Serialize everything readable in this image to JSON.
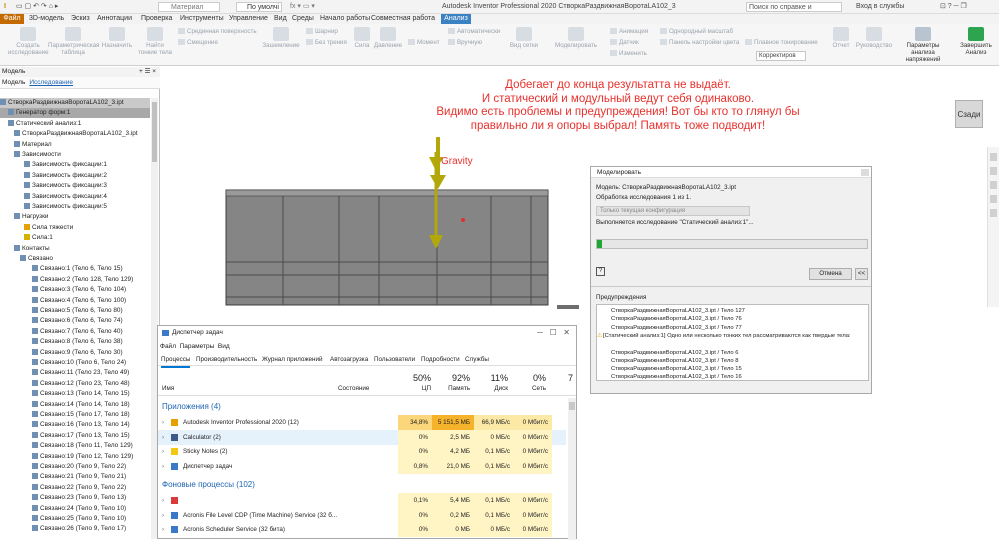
{
  "app": {
    "title": "Autodesk Inventor Professional 2020   СтворкаРаздвижнаяВоротаLA102_3",
    "material": "Материал",
    "view_mode": "По умолчі",
    "search_placeholder": "Поиск по справке и командам",
    "sign_in": "Вход в службы"
  },
  "tabs": [
    "Файл",
    "3D-модель",
    "Эскиз",
    "Аннотации",
    "Проверка",
    "Инструменты",
    "Управление",
    "Вид",
    "Среды",
    "Начало работы",
    "Совместная работа",
    "Анализ"
  ],
  "ribbon": {
    "big": [
      "Создать исследование",
      "Параметрическая таблица",
      "Назначить",
      "Найти тонкие тела",
      "Зашемление",
      "Сила",
      "Давление",
      "Моделировать",
      "Вид сетки",
      "Моделировать",
      "Отчет",
      "Руководство",
      "Параметры анализа напряжений",
      "Завершить Анализ"
    ],
    "small": [
      "Срединная поверхность",
      "Смещение",
      "Шарнир",
      "Без трения",
      "Момент",
      "Автоматически",
      "Вручную",
      "Анимация",
      "Датчик",
      "Изменить",
      "Однородный масштаб",
      "Панель настройки цвета",
      "Плавное тонирование",
      "Корректиров"
    ]
  },
  "browser": {
    "tabs": [
      "Модель",
      "Исследование"
    ],
    "items": [
      "СтворкаРаздвижнаяВоротаLA102_3.ipt",
      "Генератор форм:1",
      "Статический анализ:1",
      "СтворкаРаздвижнаяВоротаLA102_3.ipt",
      "Материал",
      "Зависимости",
      "Зависимость фиксации:1",
      "Зависимость фиксации:2",
      "Зависимость фиксации:3",
      "Зависимость фиксации:4",
      "Зависимость фиксации:5",
      "Нагрузки",
      "Сила тяжести",
      "Сила:1",
      "Контакты",
      "Связано",
      "Связано:1 (Тело 6, Тело 15)",
      "Связано:2 (Тело 128, Тело 129)",
      "Связано:3 (Тело 6, Тело 104)",
      "Связано:4 (Тело 6, Тело 100)",
      "Связано:5 (Тело 6, Тело 80)",
      "Связано:6 (Тело 6, Тело 74)",
      "Связано:7 (Тело 6, Тело 40)",
      "Связано:8 (Тело 6, Тело 38)",
      "Связано:9 (Тело 6, Тело 30)",
      "Связано:10 (Тело 6, Тело 24)",
      "Связано:11 (Тело 23, Тело 49)",
      "Связано:12 (Тело 23, Тело 48)",
      "Связано:13 (Тело 14, Тело 15)",
      "Связано:14 (Тело 14, Тело 18)",
      "Связано:15 (Тело 17, Тело 18)",
      "Связано:16 (Тело 13, Тело 14)",
      "Связано:17 (Тело 13, Тело 15)",
      "Связано:18 (Тело 11, Тело 129)",
      "Связано:19 (Тело 12, Тело 129)",
      "Связано:20 (Тело 9, Тело 22)",
      "Связано:21 (Тело 9, Тело 21)",
      "Связано:22 (Тело 9, Тело 22)",
      "Связано:23 (Тело 9, Тело 13)",
      "Связано:24 (Тело 9, Тело 10)",
      "Связано:25 (Тело 9, Тело 10)",
      "Связано:26 (Тело 9, Тело 17)"
    ]
  },
  "comment": [
    "Добегает до конца результатта не выдаёт.",
    "И статический и модульный ведут себя одинаково.",
    "Видимо есть проблемы и предупреждения! Вот бы кто то глянул бы",
    "правильно ли я опоры выбрал! Память тоже подводит!"
  ],
  "gravity": "Gravity",
  "viewcube": "Сзади",
  "sim": {
    "title": "Моделировать",
    "model": "Модель: СтворкаРаздвижнаяВоротаLA102_3.ipt",
    "processing": "Обработка исследования 1 из 1.",
    "config": "Только текущая конфигурация",
    "running": "Выполняется исследование \"Статический анализ:1\"...",
    "progress": 0.02,
    "cancel": "Отмена",
    "collapse": "<<",
    "warnings_label": "Предупреждения",
    "warnings": [
      "СтворкаРаздвижнаяВоротаLA102_3.ipt / Тело 127",
      "СтворкаРаздвижнаяВоротаLA102_3.ipt / Тело 76",
      "СтворкаРаздвижнаяВоротаLA102_3.ipt / Тело 77",
      "[Статический анализ:1] Одно или несколько тонких тел рассматриваются как твердые тела:",
      "",
      "СтворкаРаздвижнаяВоротаLA102_3.ipt / Тело 6",
      "СтворкаРаздвижнаяВоротаLA102_3.ipt / Тело 8",
      "СтворкаРаздвижнаяВоротаLA102_3.ipt / Тело 15",
      "СтворкаРаздвижнаяВоротаLA102_3.ipt / Тело 16"
    ]
  },
  "taskmgr": {
    "title": "Диспетчер задач",
    "menu": [
      "Файл",
      "Параметры",
      "Вид"
    ],
    "tabs": [
      "Процессы",
      "Производительность",
      "Журнал приложений",
      "Автозагрузка",
      "Пользователи",
      "Подробности",
      "Службы"
    ],
    "cols": {
      "name": "Имя",
      "status": "Состояние",
      "cpu_pct": "50%",
      "cpu": "ЦП",
      "mem_pct": "92%",
      "mem": "Память",
      "disk_pct": "11%",
      "disk": "Диск",
      "net_pct": "0%",
      "net": "Сеть",
      "extra": "7"
    },
    "apps_header": "Приложения (4)",
    "bg_header": "Фоновые процессы (102)",
    "apps": [
      {
        "name": "Autodesk Inventor Professional 2020 (12)",
        "cpu": "34,8%",
        "mem": "5 151,5 МБ",
        "disk": "66,9 МБ/с",
        "net": "0 Мбит/с"
      },
      {
        "name": "Calculator (2)",
        "cpu": "0%",
        "mem": "2,5 МБ",
        "disk": "0 МБ/с",
        "net": "0 Мбит/с"
      },
      {
        "name": "Sticky Notes (2)",
        "cpu": "0%",
        "mem": "4,2 МБ",
        "disk": "0,1 МБ/с",
        "net": "0 Мбит/с"
      },
      {
        "name": "Диспетчер задач",
        "cpu": "0,8%",
        "mem": "21,0 МБ",
        "disk": "0,1 МБ/с",
        "net": "0 Мбит/с"
      }
    ],
    "bg": [
      {
        "name": "",
        "cpu": "0,1%",
        "mem": "5,4 МБ",
        "disk": "0,1 МБ/с",
        "net": "0 Мбит/с"
      },
      {
        "name": "Acronis File Level CDP (Time Machine) Service (32 б...",
        "cpu": "0%",
        "mem": "0,2 МБ",
        "disk": "0,1 МБ/с",
        "net": "0 Мбит/с"
      },
      {
        "name": "Acronis Scheduler Service (32 бита)",
        "cpu": "0%",
        "mem": "0 МБ",
        "disk": "0 МБ/с",
        "net": "0 Мбит/с"
      }
    ]
  },
  "colors": {
    "accent": "#e6a000",
    "comment": "#e8312d",
    "progress": "#1ea832"
  }
}
